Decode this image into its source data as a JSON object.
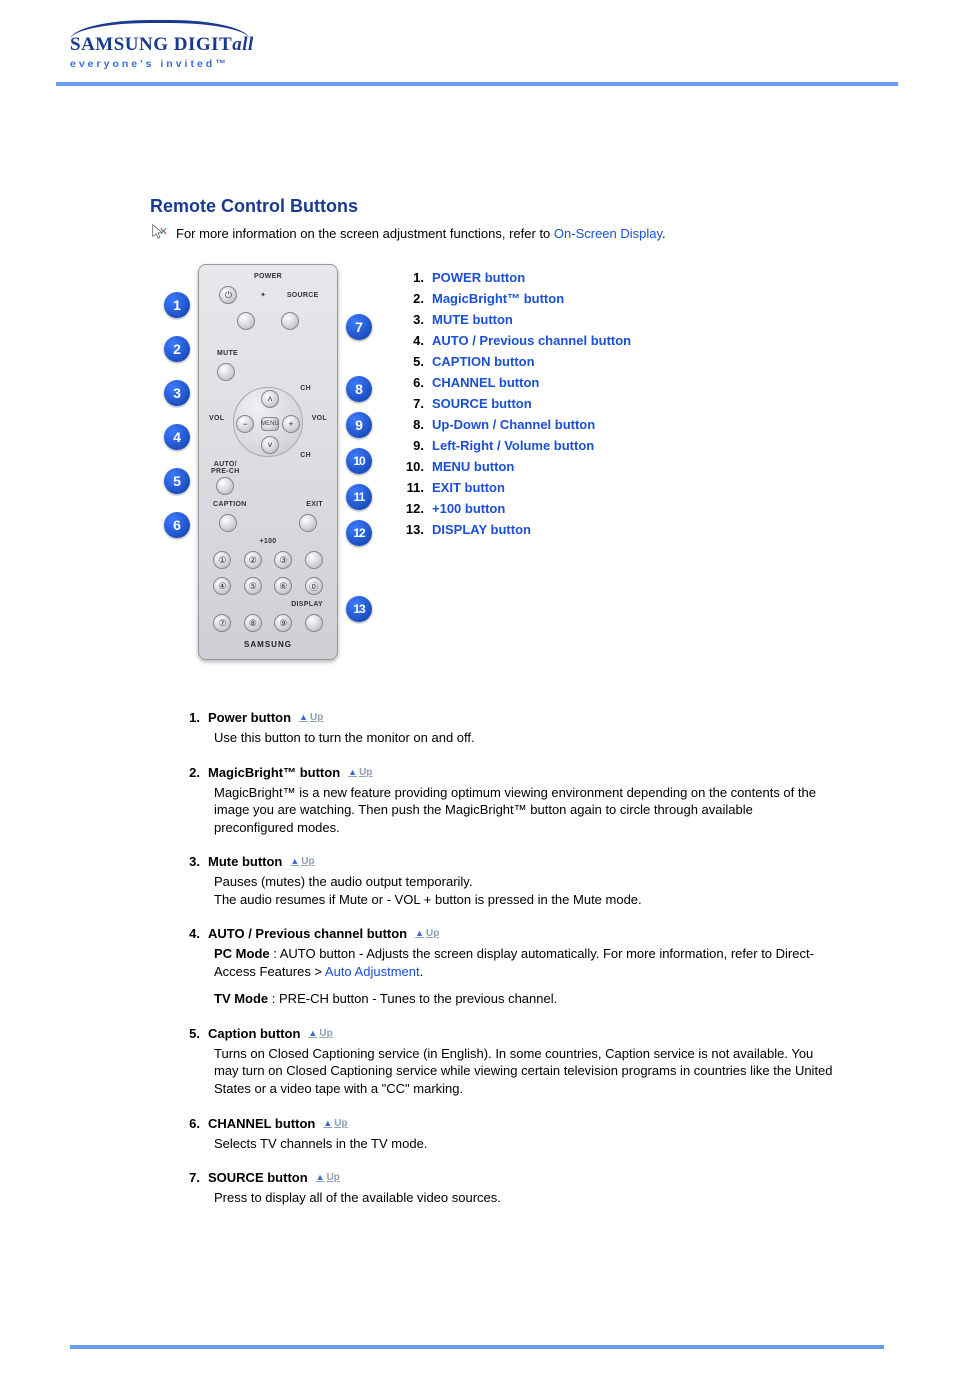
{
  "logo": {
    "main_a": "SAMSUNG DIGIT",
    "main_b": "all",
    "tagline": "everyone's invited™"
  },
  "title": "Remote Control Buttons",
  "intro_prefix": "For more information on the screen adjustment functions, refer to ",
  "intro_link": "On-Screen Display",
  "intro_suffix": ".",
  "remote": {
    "power": "POWER",
    "source": "SOURCE",
    "mute": "MUTE",
    "vol": "VOL",
    "ch": "CH",
    "auto": "AUTO/\nPRE-CH",
    "menu": "MENU",
    "caption": "CAPTION",
    "exit": "EXIT",
    "plus100": "+100",
    "display": "DISPLAY",
    "brand": "SAMSUNG"
  },
  "left_badges": [
    "1",
    "2",
    "3",
    "4",
    "5",
    "6"
  ],
  "right_badges": [
    "7",
    "8",
    "9",
    "10",
    "11",
    "12",
    "13"
  ],
  "links": [
    {
      "n": "1.",
      "t": "POWER button"
    },
    {
      "n": "2.",
      "t": "MagicBright™ button"
    },
    {
      "n": "3.",
      "t": "MUTE button"
    },
    {
      "n": "4.",
      "t": "AUTO / Previous channel button"
    },
    {
      "n": "5.",
      "t": "CAPTION button"
    },
    {
      "n": "6.",
      "t": "CHANNEL button"
    },
    {
      "n": "7.",
      "t": "SOURCE button"
    },
    {
      "n": "8.",
      "t": "Up-Down / Channel button"
    },
    {
      "n": "9.",
      "t": "Left-Right / Volume button"
    },
    {
      "n": "10.",
      "t": "MENU button"
    },
    {
      "n": "11.",
      "t": "EXIT button"
    },
    {
      "n": "12.",
      "t": "+100 button"
    },
    {
      "n": "13.",
      "t": "DISPLAY button"
    }
  ],
  "up_label": "Up",
  "desc": {
    "d1": {
      "n": "1.",
      "h": "Power button",
      "b": "Use this button to turn the monitor on and off."
    },
    "d2": {
      "n": "2.",
      "h": "MagicBright™ button",
      "b": "MagicBright™ is a new feature providing optimum viewing environment depending on the contents of the image you are watching. Then push the MagicBright™ button again to circle through available preconfigured modes."
    },
    "d3": {
      "n": "3.",
      "h": "Mute button",
      "b1": "Pauses (mutes) the audio output temporarily.",
      "b2": "The audio resumes if Mute or - VOL + button is pressed in the Mute mode."
    },
    "d4": {
      "n": "4.",
      "h": "AUTO / Previous channel button",
      "pc_label": "PC Mode",
      "pc_text": " : AUTO button - Adjusts the screen display automatically. For more information, refer to Direct-Access Features > ",
      "pc_link": "Auto Adjustment",
      "pc_suffix": ".",
      "tv_label": "TV Mode",
      "tv_text": " : PRE-CH button - Tunes to the previous channel."
    },
    "d5": {
      "n": "5.",
      "h": "Caption button",
      "b": "Turns on Closed Captioning service (in English). In some countries, Caption service is not available. You may turn on Closed Captioning service while viewing certain television programs in countries like the United States or a video tape with a \"CC\" marking."
    },
    "d6": {
      "n": "6.",
      "h": "CHANNEL button",
      "b": "Selects TV channels in the TV mode."
    },
    "d7": {
      "n": "7.",
      "h": "SOURCE button",
      "b": "Press to display all of the available video sources."
    }
  }
}
